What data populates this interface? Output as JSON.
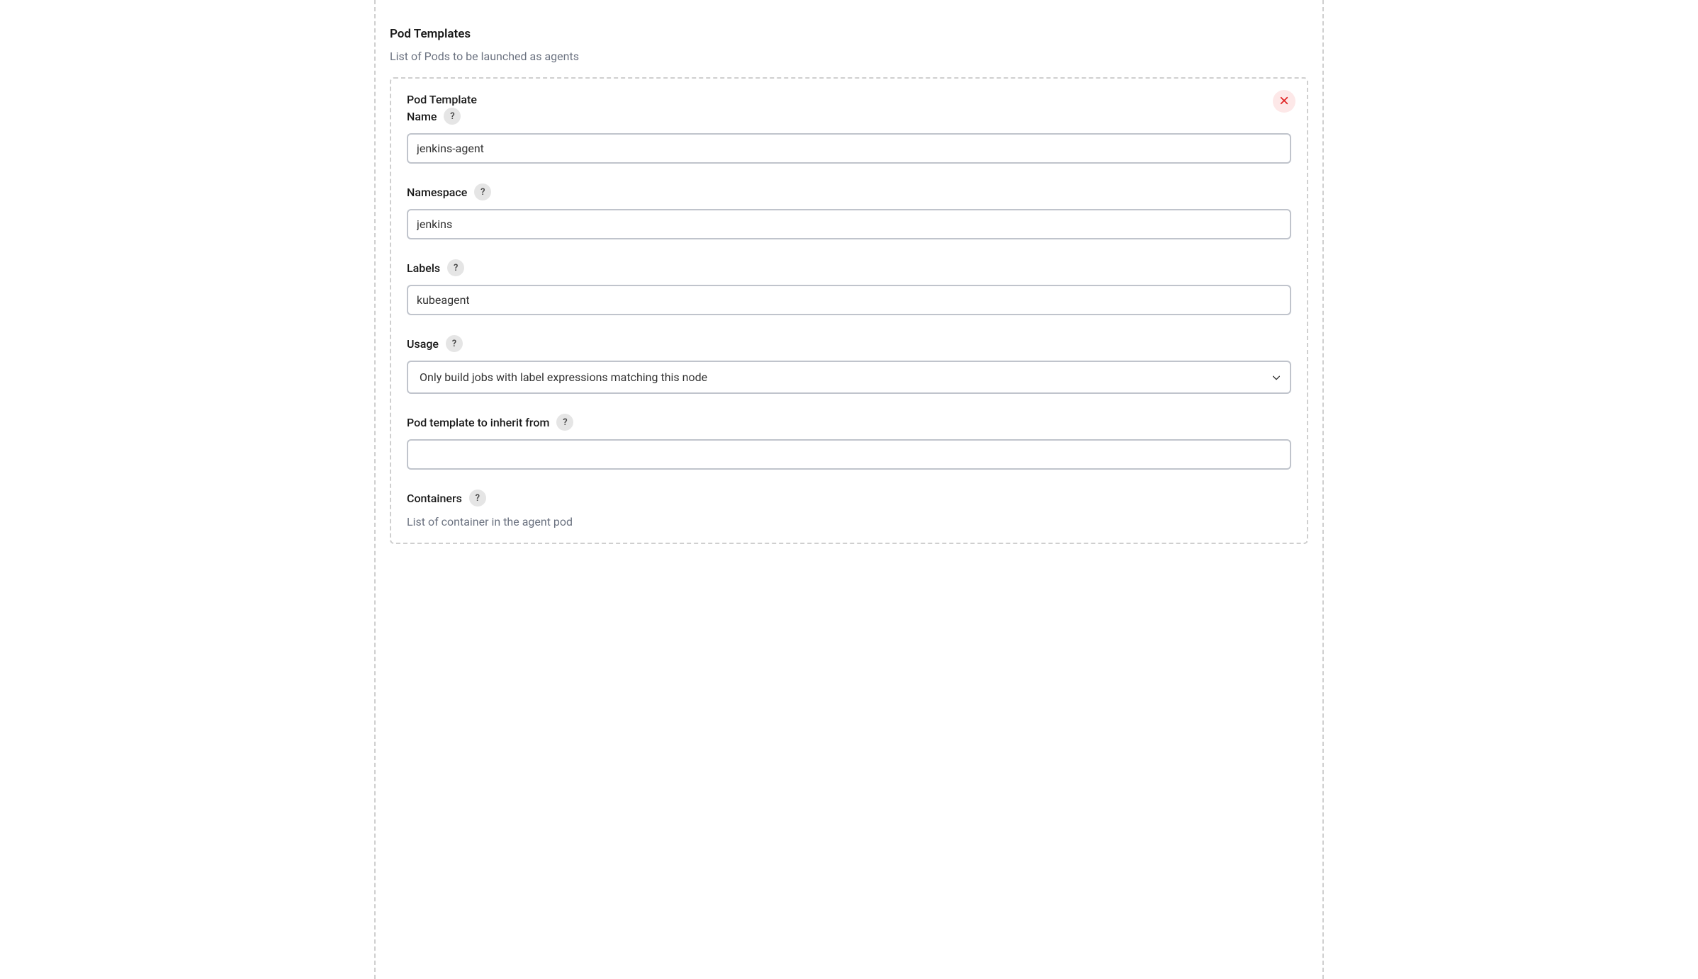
{
  "section": {
    "title": "Pod Templates",
    "subtitle": "List of Pods to be launched as agents"
  },
  "podTemplate": {
    "header": "Pod Template",
    "fields": {
      "name": {
        "label": "Name",
        "value": "jenkins-agent"
      },
      "namespace": {
        "label": "Namespace",
        "value": "jenkins"
      },
      "labels": {
        "label": "Labels",
        "value": "kubeagent"
      },
      "usage": {
        "label": "Usage",
        "selected": "Only build jobs with label expressions matching this node"
      },
      "inheritFrom": {
        "label": "Pod template to inherit from",
        "value": ""
      },
      "containers": {
        "label": "Containers",
        "description": "List of container in the agent pod"
      }
    }
  },
  "helpGlyph": "?"
}
